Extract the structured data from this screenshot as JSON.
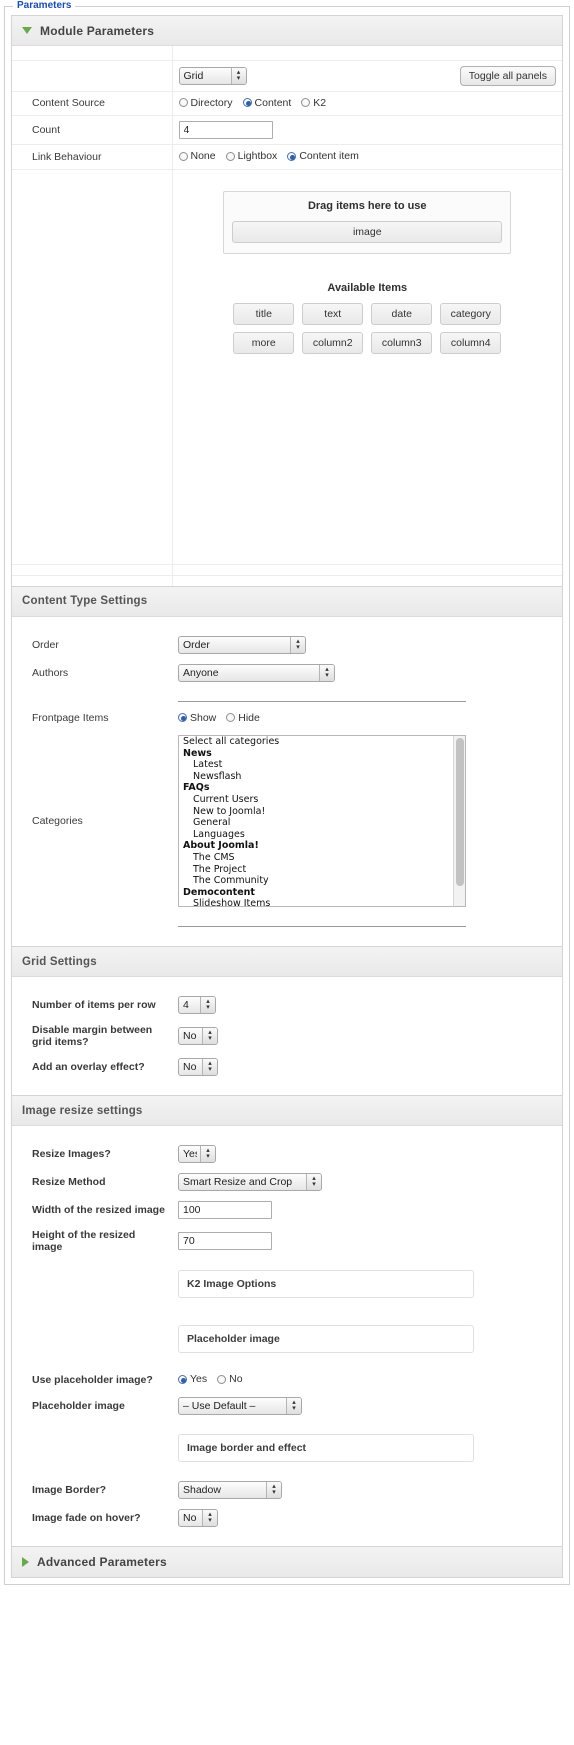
{
  "fieldset": {
    "legend": "Parameters"
  },
  "panels": {
    "module": {
      "title": "Module Parameters",
      "toggle_icon": "triangle-down-icon",
      "toggle_all_label": "Toggle all panels",
      "layout_select": {
        "value": "Grid"
      },
      "rows": [
        {
          "label": "Content Source",
          "type": "radio",
          "options": [
            {
              "label": "Directory",
              "selected": false
            },
            {
              "label": "Content",
              "selected": true
            },
            {
              "label": "K2",
              "selected": false
            }
          ]
        },
        {
          "label": "Count",
          "type": "text",
          "value": "4"
        },
        {
          "label": "Link Behaviour",
          "type": "radio",
          "options": [
            {
              "label": "None",
              "selected": false
            },
            {
              "label": "Lightbox",
              "selected": false
            },
            {
              "label": "Content item",
              "selected": true
            }
          ]
        }
      ],
      "dragdrop": {
        "drop_title": "Drag items here to use",
        "used_items": [
          "image"
        ],
        "available_title": "Available Items",
        "available_items": [
          [
            "title",
            "text",
            "date",
            "category"
          ],
          [
            "more",
            "column2",
            "column3",
            "column4"
          ]
        ]
      }
    },
    "content_type": {
      "title": "Content Type Settings",
      "rows": {
        "order_label": "Order",
        "order_value": "Order",
        "authors_label": "Authors",
        "authors_value": "Anyone",
        "frontpage_label": "Frontpage Items",
        "frontpage_options": [
          {
            "label": "Show",
            "selected": true
          },
          {
            "label": "Hide",
            "selected": false
          }
        ],
        "categories_label": "Categories",
        "categories": [
          {
            "text": "Select all categories",
            "level": 0,
            "group": false
          },
          {
            "text": "News",
            "level": 0,
            "group": true
          },
          {
            "text": "Latest",
            "level": 1,
            "group": false
          },
          {
            "text": "Newsflash",
            "level": 1,
            "group": false
          },
          {
            "text": "FAQs",
            "level": 0,
            "group": true
          },
          {
            "text": "Current Users",
            "level": 1,
            "group": false
          },
          {
            "text": "New to Joomla!",
            "level": 1,
            "group": false
          },
          {
            "text": "General",
            "level": 1,
            "group": false
          },
          {
            "text": "Languages",
            "level": 1,
            "group": false
          },
          {
            "text": "About Joomla!",
            "level": 0,
            "group": true
          },
          {
            "text": "The CMS",
            "level": 1,
            "group": false
          },
          {
            "text": "The Project",
            "level": 1,
            "group": false
          },
          {
            "text": "The Community",
            "level": 1,
            "group": false
          },
          {
            "text": "Democontent",
            "level": 0,
            "group": true
          },
          {
            "text": "Slideshow Items",
            "level": 1,
            "group": false
          }
        ]
      }
    },
    "grid": {
      "title": "Grid Settings",
      "rows": [
        {
          "label": "Number of items per row",
          "value": "4"
        },
        {
          "label": "Disable margin between grid items?",
          "value": "No"
        },
        {
          "label": "Add an overlay effect?",
          "value": "No"
        }
      ]
    },
    "image_resize": {
      "title": "Image resize settings",
      "resize_images_label": "Resize Images?",
      "resize_images_value": "Yes",
      "resize_method_label": "Resize Method",
      "resize_method_value": "Smart Resize and Crop",
      "width_label": "Width of the resized image",
      "width_value": "100",
      "height_label": "Height of the resized image",
      "height_value": "70",
      "k2_box_label": "K2 Image Options",
      "placeholder_box_label": "Placeholder image",
      "use_placeholder_label": "Use placeholder image?",
      "use_placeholder_options": [
        {
          "label": "Yes",
          "selected": true
        },
        {
          "label": "No",
          "selected": false
        }
      ],
      "placeholder_select_label": "Placeholder image",
      "placeholder_select_value": "– Use Default –",
      "border_box_label": "Image border and effect",
      "image_border_label": "Image Border?",
      "image_border_value": "Shadow",
      "image_fade_label": "Image fade on hover?",
      "image_fade_value": "No"
    },
    "advanced": {
      "title": "Advanced Parameters",
      "toggle_icon": "triangle-right-icon"
    }
  },
  "colors": {
    "legend": "#1b4ea8",
    "triangle": "#6aa84f",
    "radio_on": "#2f5fa8"
  }
}
